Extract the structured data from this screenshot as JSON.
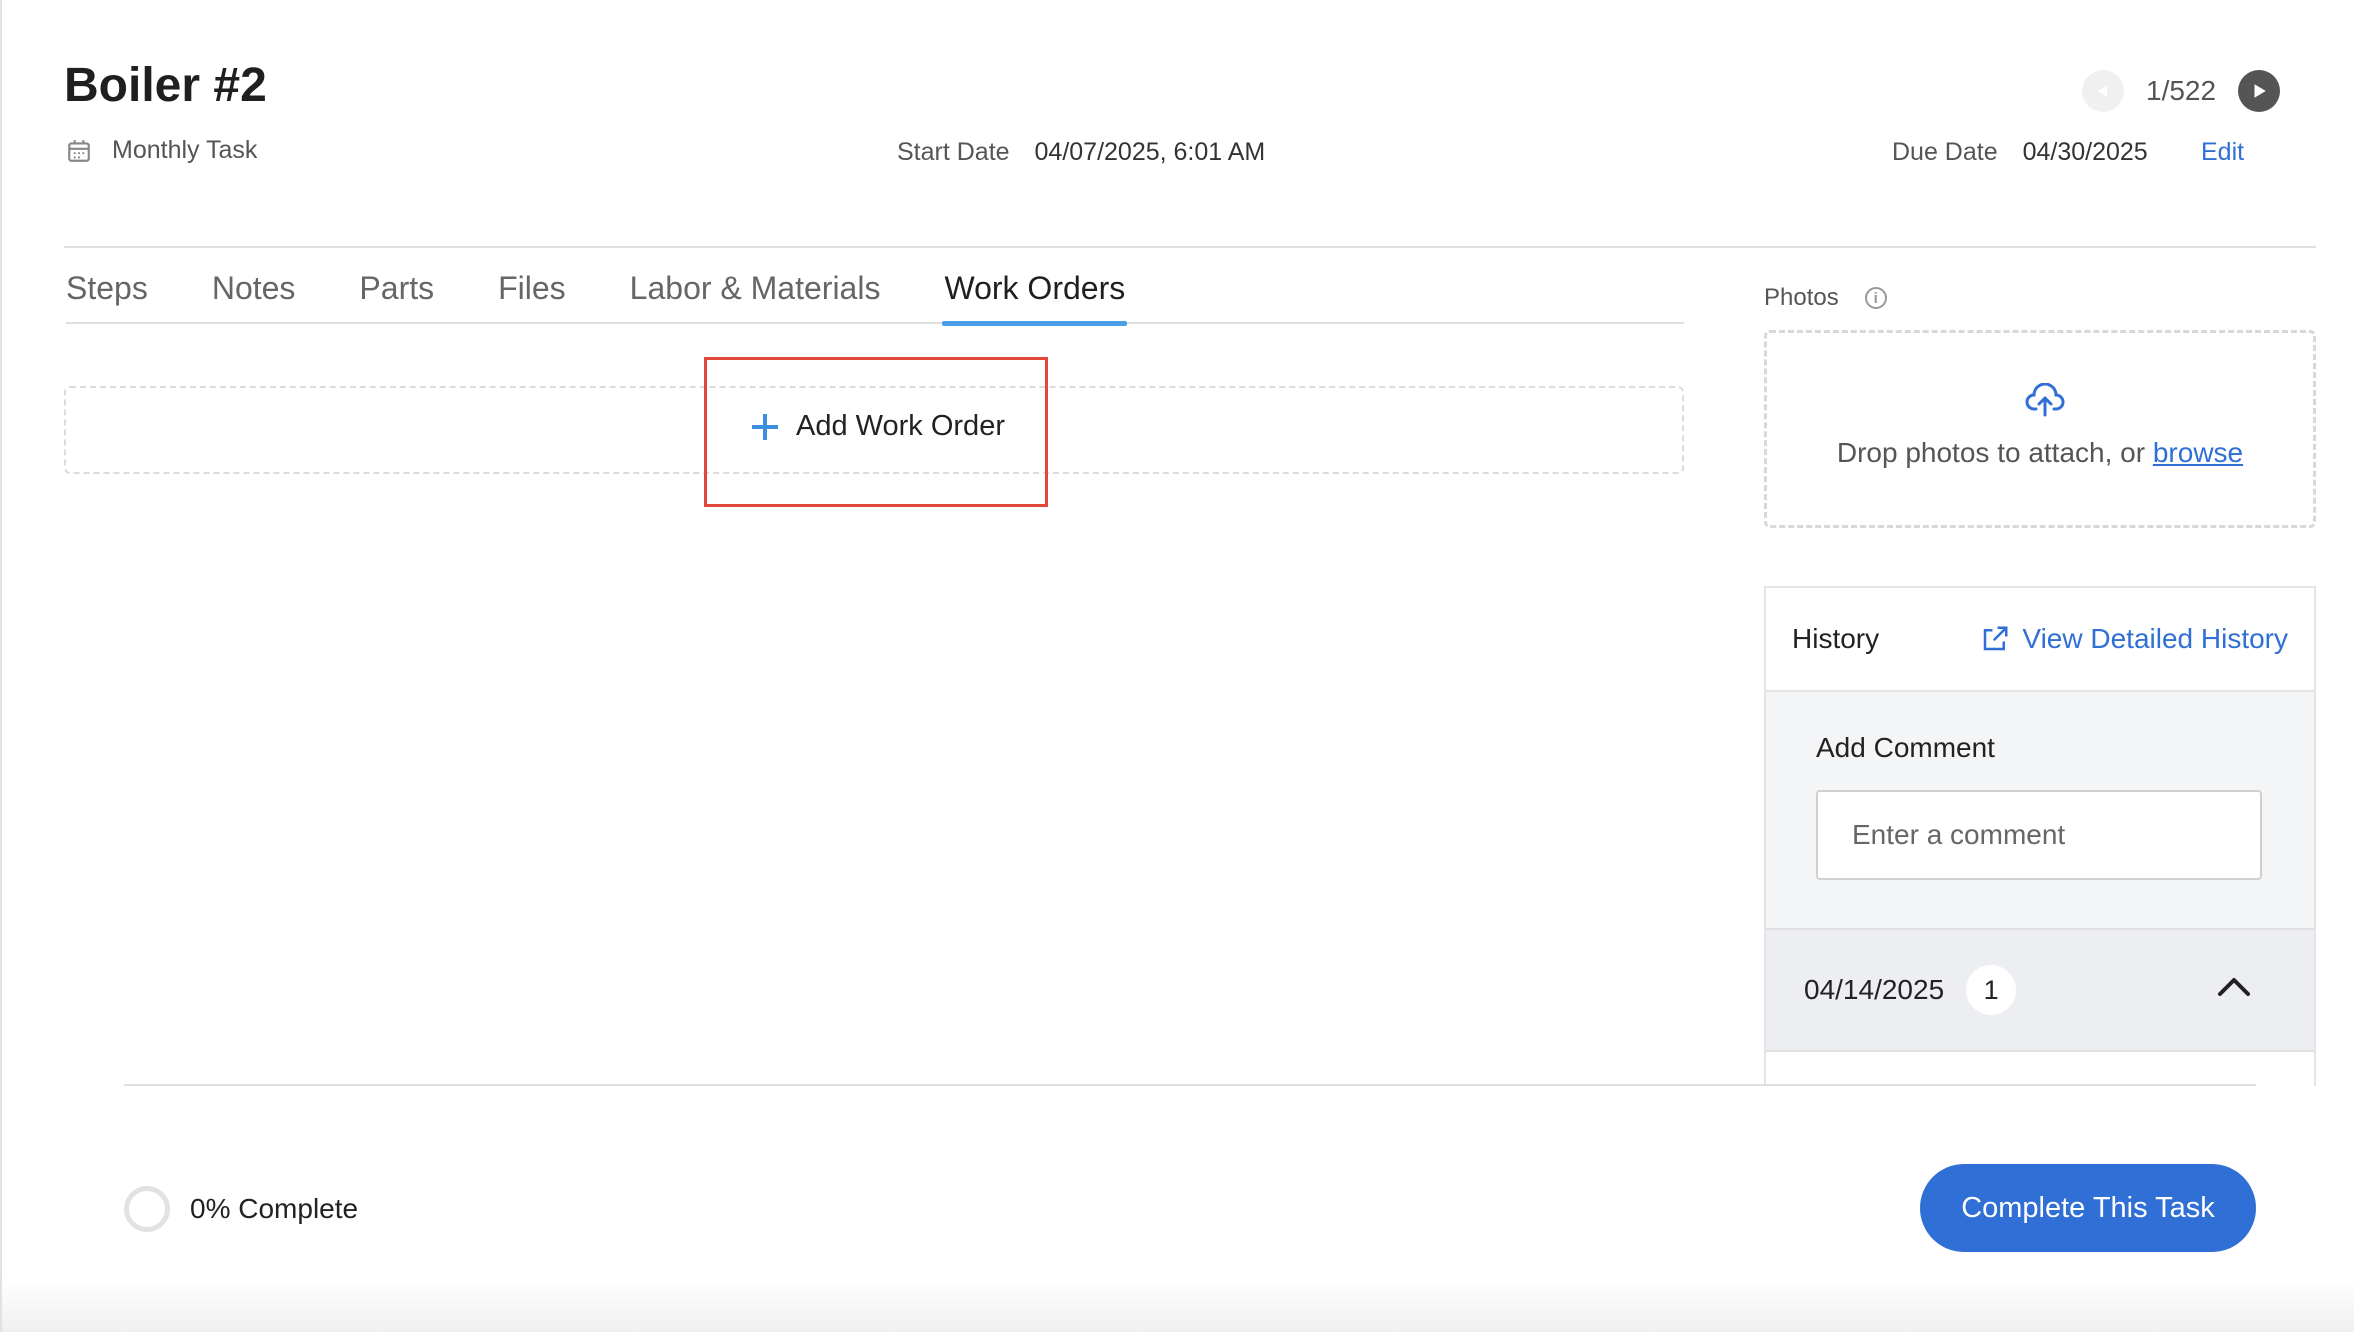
{
  "header": {
    "title": "Boiler #2",
    "task_type": "Monthly Task",
    "start_date_label": "Start Date",
    "start_date_value": "04/07/2025, 6:01 AM",
    "due_date_label": "Due Date",
    "due_date_value": "04/30/2025",
    "edit_label": "Edit",
    "pager": "1/522"
  },
  "tabs": [
    {
      "label": "Steps"
    },
    {
      "label": "Notes"
    },
    {
      "label": "Parts"
    },
    {
      "label": "Files"
    },
    {
      "label": "Labor & Materials"
    },
    {
      "label": "Work Orders",
      "active": true
    }
  ],
  "work_orders": {
    "add_label": "Add Work Order"
  },
  "photos": {
    "label": "Photos",
    "drop_text": "Drop photos to attach, or",
    "browse_label": "browse"
  },
  "history": {
    "title": "History",
    "view_detailed": "View Detailed History",
    "add_comment_label": "Add Comment",
    "comment_placeholder": "Enter a comment",
    "date": "04/14/2025",
    "count": "1"
  },
  "footer": {
    "progress_text": "0% Complete",
    "progress_value": 0,
    "complete_button": "Complete This Task"
  },
  "colors": {
    "accent": "#2f6fd6",
    "tab_underline": "#4a9fe8",
    "highlight_box": "#e2483a"
  }
}
